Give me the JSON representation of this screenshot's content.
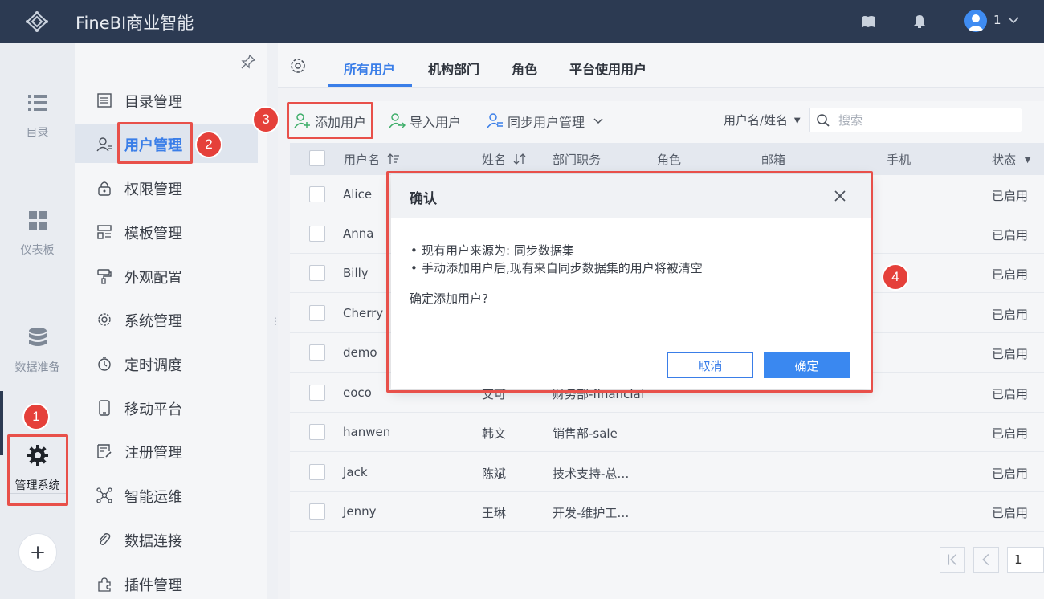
{
  "app": {
    "title": "FineBI商业智能",
    "user": "1"
  },
  "topbar_icons": [
    "book-icon",
    "bell-icon"
  ],
  "rail": {
    "items": [
      {
        "label": "目录",
        "icon": "list-icon"
      },
      {
        "label": "仪表板",
        "icon": "dashboard-icon"
      },
      {
        "label": "数据准备",
        "icon": "database-icon"
      },
      {
        "label": "管理系统",
        "icon": "gear-icon",
        "active": true
      }
    ]
  },
  "subnav": {
    "items": [
      {
        "label": "目录管理",
        "icon": "catalog-icon"
      },
      {
        "label": "用户管理",
        "icon": "user-manage-icon",
        "active": true
      },
      {
        "label": "权限管理",
        "icon": "lock-icon"
      },
      {
        "label": "模板管理",
        "icon": "template-icon"
      },
      {
        "label": "外观配置",
        "icon": "paint-icon"
      },
      {
        "label": "系统管理",
        "icon": "settings-icon"
      },
      {
        "label": "定时调度",
        "icon": "timer-icon"
      },
      {
        "label": "移动平台",
        "icon": "mobile-icon"
      },
      {
        "label": "注册管理",
        "icon": "register-icon"
      },
      {
        "label": "智能运维",
        "icon": "ops-icon"
      },
      {
        "label": "数据连接",
        "icon": "link-icon"
      },
      {
        "label": "插件管理",
        "icon": "plugin-icon"
      }
    ]
  },
  "tabs": [
    {
      "label": "所有用户",
      "active": true
    },
    {
      "label": "机构部门"
    },
    {
      "label": "角色"
    },
    {
      "label": "平台使用用户"
    }
  ],
  "toolbar": {
    "add_user": "添加用户",
    "import_user": "导入用户",
    "sync_manage": "同步用户管理",
    "filter_field": "用户名/姓名",
    "search_placeholder": "搜索"
  },
  "table": {
    "headers": {
      "username": "用户名",
      "name": "姓名",
      "dept": "部门职务",
      "role": "角色",
      "email": "邮箱",
      "phone": "手机",
      "status": "状态"
    },
    "rows": [
      {
        "username": "Alice",
        "name": "",
        "dept": "",
        "status": "已启用"
      },
      {
        "username": "Anna",
        "name": "",
        "dept": "",
        "status": "已启用"
      },
      {
        "username": "Billy",
        "name": "",
        "dept": "",
        "status": "已启用"
      },
      {
        "username": "Cherry",
        "name": "",
        "dept": "",
        "status": "已启用"
      },
      {
        "username": "demo",
        "name": "",
        "dept": "",
        "status": "已启用"
      },
      {
        "username": "eoco",
        "name": "艾可",
        "dept": "财务部-financial",
        "status": "已启用"
      },
      {
        "username": "hanwen",
        "name": "韩文",
        "dept": "销售部-sale",
        "status": "已启用"
      },
      {
        "username": "Jack",
        "name": "陈斌",
        "dept": "技术支持-总…",
        "status": "已启用"
      },
      {
        "username": "Jenny",
        "name": "王琳",
        "dept": "开发-维护工…",
        "status": "已启用"
      }
    ]
  },
  "pager": {
    "page": "1"
  },
  "modal": {
    "title": "确认",
    "bullets": [
      "现有用户来源为: 同步数据集",
      "手动添加用户后,现有来自同步数据集的用户将被清空"
    ],
    "question": "确定添加用户?",
    "cancel": "取消",
    "ok": "确定"
  },
  "annotations": [
    "1",
    "2",
    "3",
    "4"
  ],
  "colors": {
    "accent": "#3a7ee8",
    "topbar": "#2c3a52",
    "highlight": "#e8504a"
  }
}
